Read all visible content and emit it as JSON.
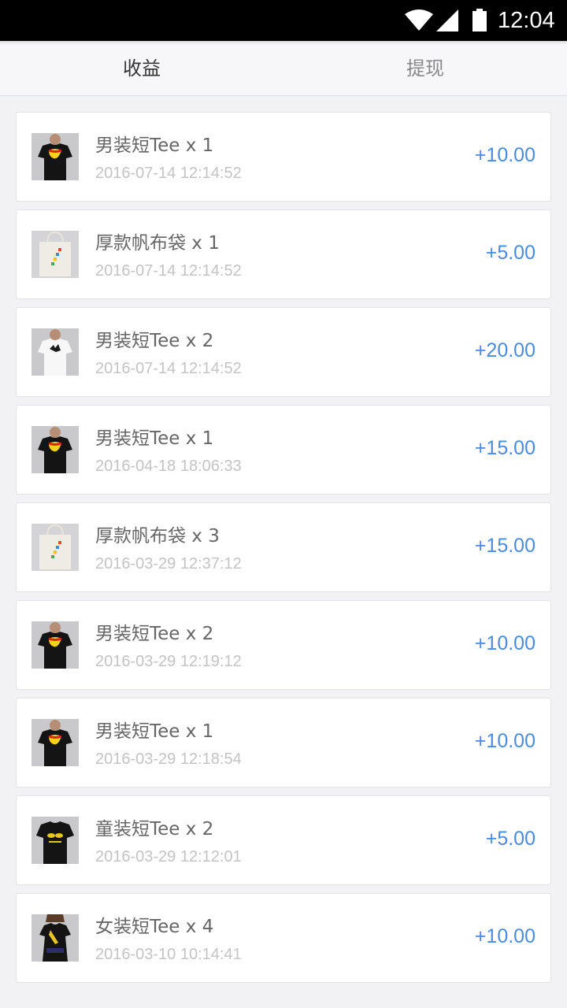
{
  "status_bar": {
    "time": "12:04",
    "icons": [
      "wifi-icon",
      "signal-icon",
      "battery-icon"
    ]
  },
  "tabs": [
    {
      "label": "收益",
      "active": true
    },
    {
      "label": "提现",
      "active": false
    }
  ],
  "colors": {
    "accent": "#4a8be0",
    "title_text": "#666666",
    "date_text": "#c4c4c4",
    "active_tab": "#333333",
    "inactive_tab": "#888888"
  },
  "records": [
    {
      "title": "男装短Tee x 1",
      "date": "2016-07-14 12:14:52",
      "amount": "+10.00",
      "product": "black-tshirt-lips"
    },
    {
      "title": "厚款帆布袋 x 1",
      "date": "2016-07-14 12:14:52",
      "amount": "+5.00",
      "product": "canvas-tote-bag"
    },
    {
      "title": "男装短Tee x 2",
      "date": "2016-07-14 12:14:52",
      "amount": "+20.00",
      "product": "white-tshirt-cat"
    },
    {
      "title": "男装短Tee x 1",
      "date": "2016-04-18 18:06:33",
      "amount": "+15.00",
      "product": "black-tshirt-lips"
    },
    {
      "title": "厚款帆布袋 x 3",
      "date": "2016-03-29 12:37:12",
      "amount": "+15.00",
      "product": "canvas-tote-bag"
    },
    {
      "title": "男装短Tee x 2",
      "date": "2016-03-29 12:19:12",
      "amount": "+10.00",
      "product": "black-tshirt-lips"
    },
    {
      "title": "男装短Tee x 1",
      "date": "2016-03-29 12:18:54",
      "amount": "+10.00",
      "product": "black-tshirt-lips"
    },
    {
      "title": "童装短Tee x 2",
      "date": "2016-03-29 12:12:01",
      "amount": "+5.00",
      "product": "kids-black-tshirt"
    },
    {
      "title": "女装短Tee x 4",
      "date": "2016-03-10 10:14:41",
      "amount": "+10.00",
      "product": "womens-black-tshirt"
    }
  ]
}
